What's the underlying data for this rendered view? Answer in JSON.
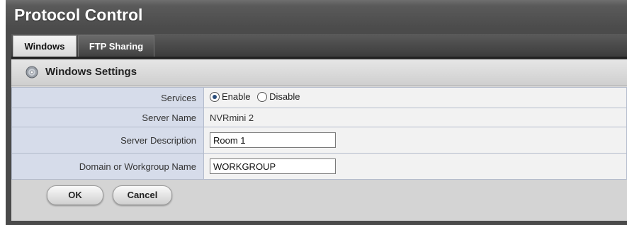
{
  "window": {
    "title": "Protocol Control"
  },
  "tabs": [
    {
      "label": "Windows",
      "active": true
    },
    {
      "label": "FTP Sharing",
      "active": false
    }
  ],
  "section": {
    "title": "Windows Settings",
    "icon": "disc-icon"
  },
  "settings": {
    "services": {
      "label": "Services",
      "options": [
        "Enable",
        "Disable"
      ],
      "selected": "Enable"
    },
    "server_name": {
      "label": "Server Name",
      "value": "NVRmini 2"
    },
    "server_description": {
      "label": "Server Description",
      "value": "Room 1"
    },
    "workgroup": {
      "label": "Domain or Workgroup Name",
      "value": "WORKGROUP"
    }
  },
  "buttons": {
    "ok": "OK",
    "cancel": "Cancel"
  },
  "colors": {
    "label_bg": "#d6dcea",
    "frame": "#4a4a4a"
  }
}
